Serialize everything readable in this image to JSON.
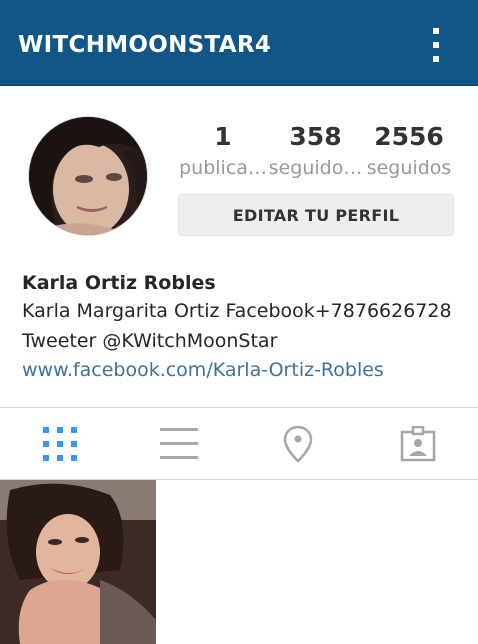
{
  "header": {
    "username": "WITCHMOONSTAR4",
    "menu_icon": "kebab-menu-icon"
  },
  "profile": {
    "avatar_icon": "profile-photo",
    "stats": [
      {
        "value": "1",
        "label": "publica…"
      },
      {
        "value": "358",
        "label": "seguido…"
      },
      {
        "value": "2556",
        "label": "seguidos"
      }
    ],
    "edit_button": "EDITAR TU PERFIL"
  },
  "bio": {
    "name": "Karla Ortiz Robles",
    "line1": "Karla Margarita Ortiz Facebook+7876626728",
    "line2": "Tweeter @KWitchMoonStar",
    "link": "www.facebook.com/Karla-Ortiz-Robles"
  },
  "tabs": {
    "items": [
      "grid-icon",
      "list-icon",
      "location-pin-icon",
      "tagged-photos-icon"
    ],
    "active_color": "#3897f0",
    "inactive_color": "#a5a7aa"
  },
  "colors": {
    "header_bg": "#125688",
    "link": "#3f729b"
  }
}
